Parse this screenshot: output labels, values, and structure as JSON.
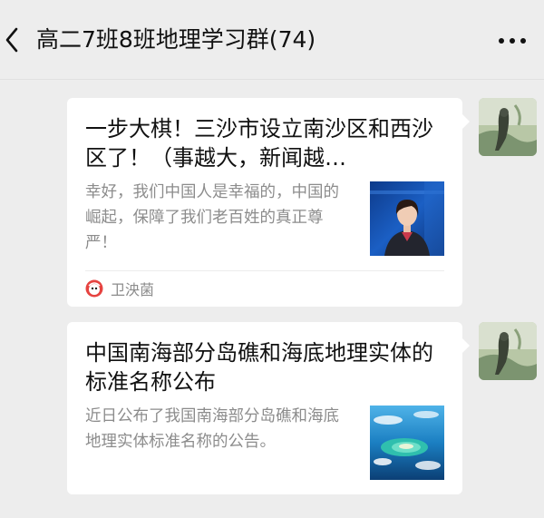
{
  "header": {
    "title": "高二7班8班地理学习群(74)",
    "back_icon": "chevron-left-icon",
    "more_icon": "ellipsis-icon"
  },
  "messages": [
    {
      "title": "一步大棋！三沙市设立南沙区和西沙区了！（事越大，新闻越…",
      "description": "幸好，我们中国人是幸福的，中国的崛起，保障了我们老百姓的真正尊严！",
      "thumbnail": "news-anchor-thumbnail",
      "source": "卫泱菌",
      "source_icon": "source-logo-icon"
    },
    {
      "title": "中国南海部分岛礁和海底地理实体的标准名称公布",
      "description": "近日公布了我国南海部分岛礁和海底地理实体标准名称的公告。",
      "thumbnail": "island-satellite-thumbnail"
    }
  ],
  "colors": {
    "background": "#ededed",
    "card": "#ffffff",
    "title_text": "#111111",
    "secondary_text": "#8c8c8c"
  }
}
